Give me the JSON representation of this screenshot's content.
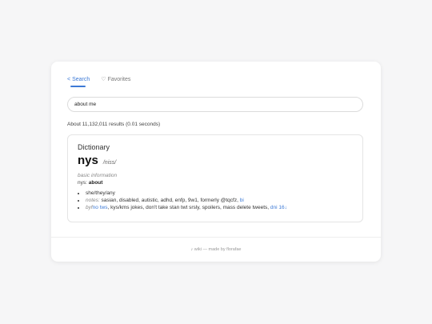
{
  "tabs": [
    {
      "icon": "<",
      "label": "Search",
      "active": true
    },
    {
      "icon": "♡",
      "label": "Favorites",
      "active": false
    }
  ],
  "search": {
    "value": "about me"
  },
  "results_meta": "About 11,132,011 results (0.01 seconds)",
  "dictionary": {
    "heading": "Dictionary",
    "word": "nys",
    "pronunciation": "/niss/",
    "sense": "basic information",
    "definition_prefix": "nys:",
    "definition_word": "about",
    "items": {
      "pronouns": "she/they/any",
      "notes_label": "notes:",
      "notes_text": "sasian, disabled, autistic, adhd, enfp, 9w1, formerly @tqcfz,",
      "notes_link": "bi",
      "byf_label": "byf",
      "byf_link": "no tws",
      "byf_text": ", kys/kms jokes, don't take stan twt srsly, spoilers, mass delete tweets,",
      "byf_link2": "dni 16↓"
    }
  },
  "footer": "♪ wiki — made by florafae"
}
